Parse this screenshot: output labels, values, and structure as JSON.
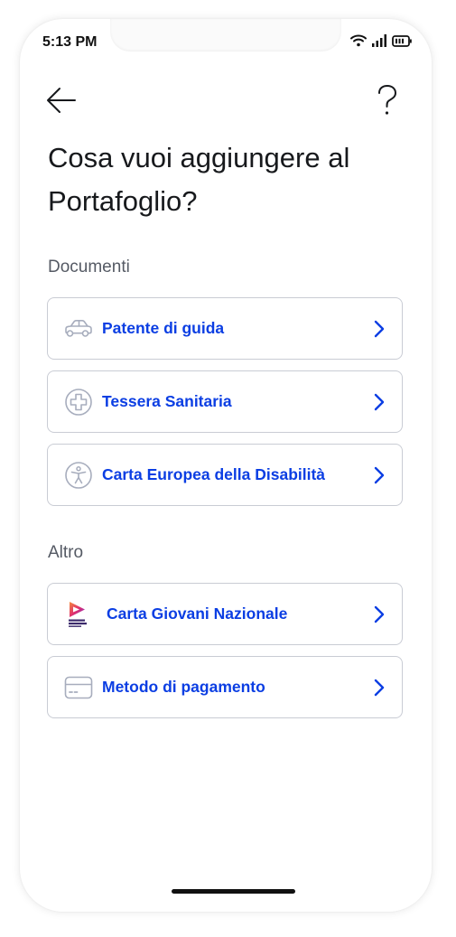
{
  "status": {
    "time": "5:13 PM"
  },
  "header": {
    "title": "Cosa vuoi aggiungere al Portafoglio?"
  },
  "sections": [
    {
      "label": "Documenti",
      "items": [
        {
          "label": "Patente di guida",
          "icon": "car-icon"
        },
        {
          "label": "Tessera Sanitaria",
          "icon": "health-cross-icon"
        },
        {
          "label": "Carta Europea della Disabilità",
          "icon": "accessibility-icon"
        }
      ]
    },
    {
      "label": "Altro",
      "items": [
        {
          "label": "Carta Giovani Nazionale",
          "icon": "carta-giovani-logo"
        },
        {
          "label": "Metodo di pagamento",
          "icon": "credit-card-icon"
        }
      ]
    }
  ],
  "colors": {
    "accent": "#0b3ee3",
    "icon_muted": "#a7adbd",
    "border": "#c9ccd4"
  }
}
